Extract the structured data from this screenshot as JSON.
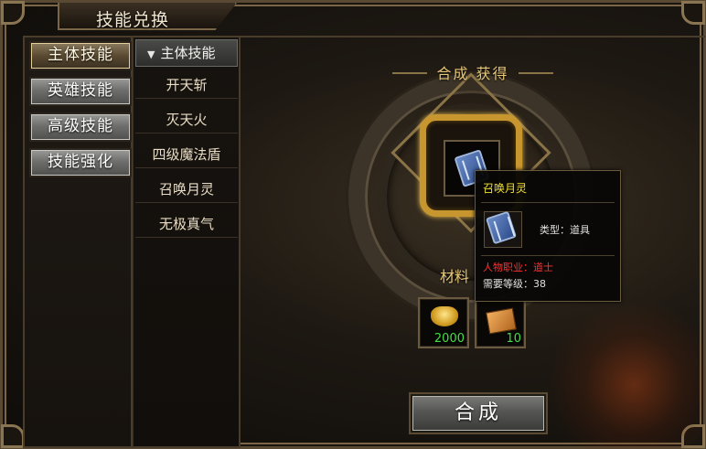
{
  "window": {
    "title": "技能兑换"
  },
  "categories": [
    {
      "label": "主体技能",
      "active": true
    },
    {
      "label": "英雄技能",
      "active": false
    },
    {
      "label": "高级技能",
      "active": false
    },
    {
      "label": "技能强化",
      "active": false
    }
  ],
  "skill_list": {
    "header": "主体技能",
    "items": [
      "开天斩",
      "灭天火",
      "四级魔法盾",
      "召唤月灵",
      "无极真气"
    ]
  },
  "main": {
    "obtain_label": "合成  获得",
    "materials_label": "材料",
    "materials": [
      {
        "icon": "gold-ingot-icon",
        "count": "2000"
      },
      {
        "icon": "scroll-icon",
        "count": "10"
      }
    ],
    "compose_button": "合成"
  },
  "tooltip": {
    "name": "召唤月灵",
    "type": "类型：道具",
    "profession": "人物职业：道士",
    "level": "需要等级：38"
  },
  "colors": {
    "gold_text": "#e8c878",
    "count_green": "#40e040",
    "tooltip_name": "#f0e030",
    "tooltip_red": "#ff3030"
  }
}
